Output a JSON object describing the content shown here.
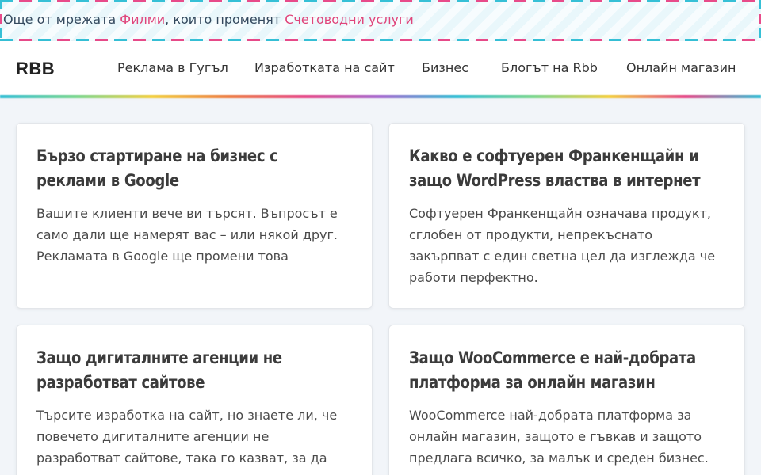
{
  "topbar": {
    "prefix": "Още от мрежата",
    "link1": "Филми",
    "middle": ", които променят",
    "link2": "Счетоводни услуги"
  },
  "header": {
    "logo": "RBB",
    "nav": [
      {
        "label": "Реклама в Гугъл"
      },
      {
        "label": "Изработката на сайт"
      },
      {
        "label": "Бизнес"
      },
      {
        "label": "Блогът на Rbb"
      },
      {
        "label": "Онлайн магазин"
      }
    ]
  },
  "cards": [
    {
      "title": "Бързо стартиране на бизнес с реклами в Google",
      "excerpt": "Вашите клиенти вече ви търсят. Въпросът е само дали ще намерят вас – или някой друг. Рекламата в Google ще промени това"
    },
    {
      "title": "Какво е софтуерен Франкенщайн и защо WordPress властва в интернет",
      "excerpt": "Софтуерен Франкенщайн означава продукт, сглобен от продукти, непрекъснато закърпват с един светна цел да изглежда че работи перфектно."
    },
    {
      "title": "Защо дигиталните агенции не разработват сайтове",
      "excerpt": "Търсите изработка на сайт, но знаете ли, че повечето дигиталните агенции не разработват сайтове, така го казват, за да изглежда по-"
    },
    {
      "title": "Защо WooCommerce е най-добрата платформа за онлайн магазин",
      "excerpt": "WooCommerce най-добрата платформа за онлайн магазин, защото е гъвкав и защото предлага всичко, за малък и среден бизнес."
    }
  ],
  "colors": {
    "link_accent": "#e0457b",
    "banner_dash_cyan": "#36c0d6",
    "banner_dash_pink": "#e84b8a"
  }
}
